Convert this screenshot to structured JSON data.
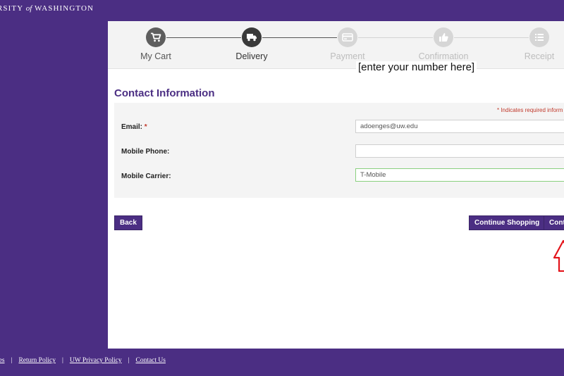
{
  "header": {
    "brand_prefix": "RSITY",
    "brand_of": "of",
    "brand_suffix": "WASHINGTON"
  },
  "steps": [
    {
      "label": "My Cart",
      "icon": "cart-icon",
      "state": "done"
    },
    {
      "label": "Delivery",
      "icon": "truck-icon",
      "state": "current"
    },
    {
      "label": "Payment",
      "icon": "credit-card-icon",
      "state": "todo"
    },
    {
      "label": "Confirmation",
      "icon": "thumbs-up-icon",
      "state": "todo"
    },
    {
      "label": "Receipt",
      "icon": "list-icon",
      "state": "todo"
    }
  ],
  "contact": {
    "title": "Contact Information",
    "required_note": "* Indicates required inform",
    "email_label": "Email:",
    "email_required_marker": "*",
    "email_value": "adoenges@uw.edu",
    "phone_label": "Mobile Phone:",
    "phone_overlay": "[enter your number here]",
    "carrier_label": "Mobile Carrier:",
    "carrier_value": "T-Mobile"
  },
  "buttons": {
    "back": "Back",
    "continue_shopping": "Continue Shopping",
    "continue": "Cont"
  },
  "footer": {
    "links": [
      "vices",
      "Return Policy",
      "UW Privacy Policy",
      "Contact Us"
    ],
    "separator": "|"
  },
  "colors": {
    "brand_purple": "#4b2e83",
    "annotation_red": "#e3141b",
    "required_red": "#c0392b",
    "carrier_focus_green": "#8ad07f"
  }
}
